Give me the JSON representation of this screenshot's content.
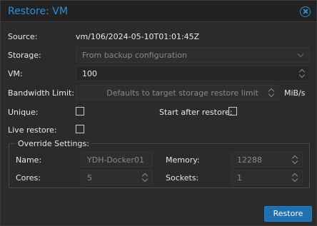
{
  "dialog": {
    "title": "Restore: VM",
    "source": {
      "label": "Source:",
      "value": "vm/106/2024-05-10T01:01:45Z"
    },
    "storage": {
      "label": "Storage:",
      "value": "From backup configuration"
    },
    "vm": {
      "label": "VM:",
      "value": "100"
    },
    "bandwidth": {
      "label": "Bandwidth Limit:",
      "placeholder": "Defaults to target storage restore limit",
      "unit": "MiB/s"
    },
    "unique": {
      "label": "Unique:",
      "checked": false
    },
    "start_after_restore": {
      "label": "Start after restore:",
      "checked": false
    },
    "live_restore": {
      "label": "Live restore:",
      "checked": false
    },
    "override": {
      "legend": "Override Settings:",
      "name": {
        "label": "Name:",
        "value": "YDH-Docker01"
      },
      "memory": {
        "label": "Memory:",
        "value": "12288"
      },
      "cores": {
        "label": "Cores:",
        "value": "5"
      },
      "sockets": {
        "label": "Sockets:",
        "value": "1"
      }
    },
    "restore_button": "Restore"
  },
  "colors": {
    "accent": "#2d8fd8",
    "button": "#1f6fb2",
    "background": "#2b2b2b"
  },
  "icons": {
    "close": "close-circle-icon",
    "spinner": "spinner-arrows-icon",
    "dropdown": "chevron-down-icon"
  }
}
